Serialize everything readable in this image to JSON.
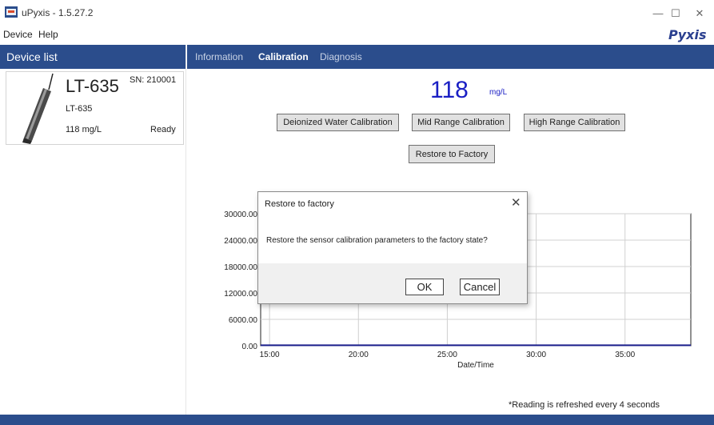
{
  "window": {
    "title": "uPyxis - 1.5.27.2",
    "minimize_glyph": "—",
    "maximize_glyph": "☐",
    "close_glyph": "✕"
  },
  "menu": {
    "device": "Device",
    "help": "Help"
  },
  "brand": "Pyxis",
  "device_list": {
    "header": "Device list",
    "devices": [
      {
        "name": "LT-635",
        "sn": "SN: 210001",
        "model": "LT-635",
        "reading": "118  mg/L",
        "status": "Ready"
      }
    ]
  },
  "tabs": [
    {
      "label": "Information",
      "active": false
    },
    {
      "label": "Calibration",
      "active": true
    },
    {
      "label": "Diagnosis",
      "active": false
    }
  ],
  "reading": {
    "value": "118",
    "unit": "mg/L"
  },
  "calibration": {
    "di_water_label": "Deionized Water Calibration",
    "mid_range_label": "Mid Range Calibration",
    "high_range_label": "High Range Calibration",
    "restore_label": "Restore to Factory"
  },
  "refresh_note": "*Reading is refreshed every 4 seconds",
  "dialog": {
    "title": "Restore to factory",
    "close_glyph": "✕",
    "message": "Restore the sensor calibration parameters to the factory state?",
    "ok_label": "OK",
    "cancel_label": "Cancel"
  },
  "colors": {
    "header_bg": "#2b4d8c",
    "reading_text": "#1a1fc4",
    "line_series": "#1a1f8c"
  },
  "chart_data": {
    "type": "line",
    "xlabel": "Date/Time",
    "ylabel": "",
    "x_ticks": [
      "15:00",
      "20:00",
      "25:00",
      "30:00",
      "35:00"
    ],
    "x_range": [
      14.5,
      38.7
    ],
    "y_ticks": [
      "0.00",
      "6000.00",
      "12000.00",
      "18000.00",
      "24000.00",
      "30000.00"
    ],
    "ylim": [
      0,
      30000
    ],
    "grid": true,
    "series": [
      {
        "x": [
          14.5,
          38.7
        ],
        "y": [
          118,
          118
        ]
      }
    ]
  }
}
